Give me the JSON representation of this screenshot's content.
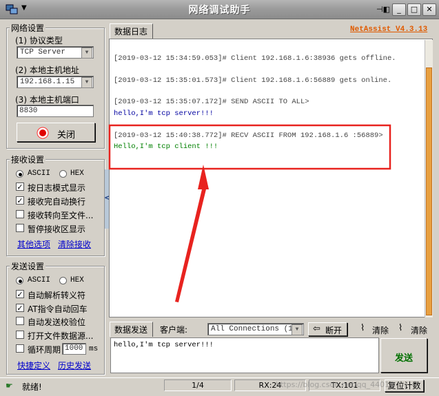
{
  "window": {
    "title": "网络调试助手",
    "brand": "NetAssist V4.3.13",
    "menu_arrow": "▼",
    "pin_icon": "⊣◧",
    "min_label": "_",
    "max_label": "□",
    "close_label": "✕"
  },
  "network": {
    "group_title": "网络设置",
    "protocol_label": "(1) 协议类型",
    "protocol_value": "TCP Server",
    "host_label": "(2) 本地主机地址",
    "host_value": "192.168.1.15",
    "port_label": "(3) 本地主机端口",
    "port_value": "8830",
    "close_button": "关闭"
  },
  "receive": {
    "group_title": "接收设置",
    "ascii_label": "ASCII",
    "hex_label": "HEX",
    "options": [
      {
        "label": "按日志模式显示",
        "checked": true
      },
      {
        "label": "接收完自动换行",
        "checked": true
      },
      {
        "label": "接收转向至文件...",
        "checked": false
      },
      {
        "label": "暂停接收区显示",
        "checked": false
      }
    ],
    "link_more": "其他选项",
    "link_clear": "清除接收"
  },
  "send": {
    "group_title": "发送设置",
    "ascii_label": "ASCII",
    "hex_label": "HEX",
    "options": [
      {
        "label": "自动解析转义符",
        "checked": true
      },
      {
        "label": "AT指令自动回车",
        "checked": true
      },
      {
        "label": "自动发送校验位",
        "checked": false
      },
      {
        "label": "打开文件数据源...",
        "checked": false
      }
    ],
    "cycle_label": "循环周期",
    "cycle_value": "1000",
    "cycle_unit": "ms",
    "link_shortcut": "快捷定义",
    "link_history": "历史发送"
  },
  "log": {
    "tab_label": "数据日志",
    "collapse_glyph": "<",
    "lines": [
      {
        "text": "[2019-03-12 15:34:59.053]# Client 192.168.1.6:38936 gets offline.",
        "style": "gray"
      },
      {
        "text": "[2019-03-12 15:35:01.573]# Client 192.168.1.6:56889 gets online.",
        "style": "gray"
      },
      {
        "text": "[2019-03-12 15:35:07.172]# SEND ASCII TO ALL>",
        "style": "gray"
      },
      {
        "text": "hello,I'm tcp server!!!",
        "style": "blue"
      },
      {
        "text": "[2019-03-12 15:40:38.772]# RECV ASCII FROM 192.168.1.6 :56889>",
        "style": "gray"
      },
      {
        "text": "Hello,I'm tcp client !!!",
        "style": "green"
      }
    ],
    "highlight_color": "#e8231f"
  },
  "sendpanel": {
    "tab_label": "数据发送",
    "client_label": "客户端:",
    "client_value": "All Connections (1)",
    "disconnect_button": "断开",
    "clear1_label": "清除",
    "clear2_label": "清除",
    "send_text": "hello,I'm tcp server!!!",
    "send_button": "发送"
  },
  "status": {
    "ready": "就绪!",
    "page": "1/4",
    "rx": "RX:24",
    "tx": "TX:101",
    "reset": "复位计数",
    "watermark": "https://blog.csdn.net/qq_44010"
  }
}
